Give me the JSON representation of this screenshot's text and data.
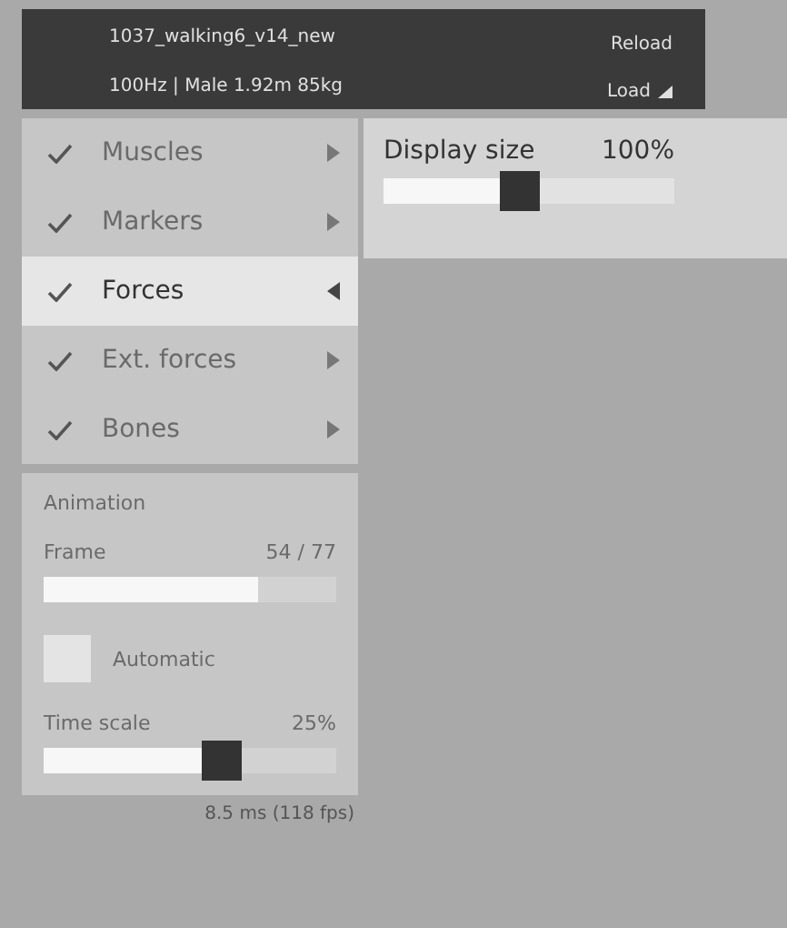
{
  "header": {
    "title": "1037_walking6_v14_new",
    "subtitle": "100Hz | Male 1.92m 85kg",
    "reload": "Reload",
    "load": "Load"
  },
  "menu": [
    {
      "label": "Muscles",
      "checked": true,
      "expanded": false
    },
    {
      "label": "Markers",
      "checked": true,
      "expanded": false
    },
    {
      "label": "Forces",
      "checked": true,
      "expanded": true
    },
    {
      "label": "Ext. forces",
      "checked": true,
      "expanded": false
    },
    {
      "label": "Bones",
      "checked": true,
      "expanded": false
    }
  ],
  "settings": {
    "label": "Display size",
    "value": "100%",
    "level": 0.47
  },
  "animation": {
    "title": "Animation",
    "frame": {
      "label": "Frame",
      "value": "54 / 77",
      "level": 0.73
    },
    "automatic_label": "Automatic",
    "automatic": false,
    "time_scale": {
      "label": "Time scale",
      "value": "25%",
      "level": 0.61
    }
  },
  "status": "8.5 ms (118 fps)"
}
